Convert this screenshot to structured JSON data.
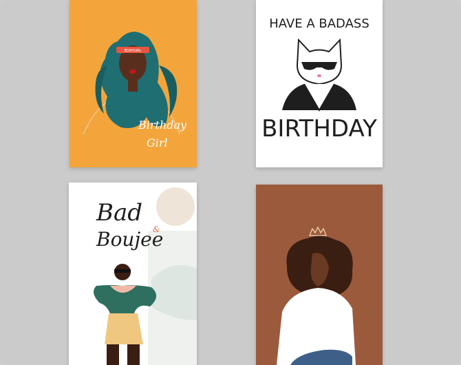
{
  "cards": [
    {
      "id": "birthday-girl",
      "lines": [
        "Birthday",
        "Girl"
      ],
      "visor_text": "BDAYGIRL"
    },
    {
      "id": "badass-birthday",
      "top_text": "HAVE A BADASS",
      "bottom_text": "BIRTHDAY"
    },
    {
      "id": "bad-boujee",
      "lines": [
        "Bad",
        "&",
        "Boujee"
      ]
    },
    {
      "id": "afro-woman"
    }
  ],
  "colors": {
    "background": "#cbcbcb",
    "card1_bg": "#f3a53c",
    "card4_bg": "#9c5a3c",
    "hair_teal": "#1f6e72",
    "sweater_green": "#2f6f5f"
  }
}
